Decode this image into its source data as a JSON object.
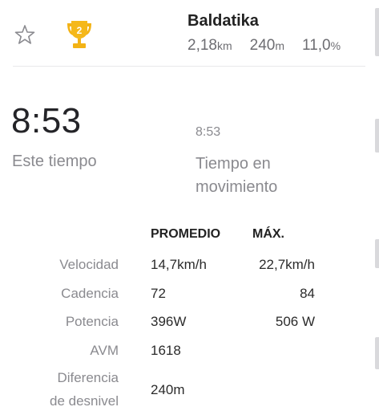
{
  "segment": {
    "name": "Baldatika",
    "distance": "2,18",
    "distance_unit": "km",
    "elevation": "240",
    "elevation_unit": "m",
    "grade": "11,0",
    "grade_unit": "%",
    "trophy_rank": "2",
    "icons": {
      "favorite": "star-outline-icon",
      "trophy": "trophy-icon"
    },
    "colors": {
      "trophy": "#f3b316"
    }
  },
  "effort": {
    "elapsed_time": "8:53",
    "elapsed_label": "Este tiempo",
    "moving_time": "8:53",
    "moving_label": "Tiempo en movimiento"
  },
  "stats": {
    "headers": {
      "avg": "PROMEDIO",
      "max": "MÁX."
    },
    "rows": [
      {
        "label": "Velocidad",
        "avg": "14,7km/h",
        "max": "22,7km/h"
      },
      {
        "label": "Cadencia",
        "avg": "72",
        "max": "84"
      },
      {
        "label": "Potencia",
        "avg": "396W",
        "max": "506 W"
      },
      {
        "label": "AVM",
        "avg": "1618",
        "max": ""
      },
      {
        "label_line1": "Diferencia",
        "label_line2": "de desnivel",
        "avg": "240m",
        "max": ""
      }
    ]
  }
}
